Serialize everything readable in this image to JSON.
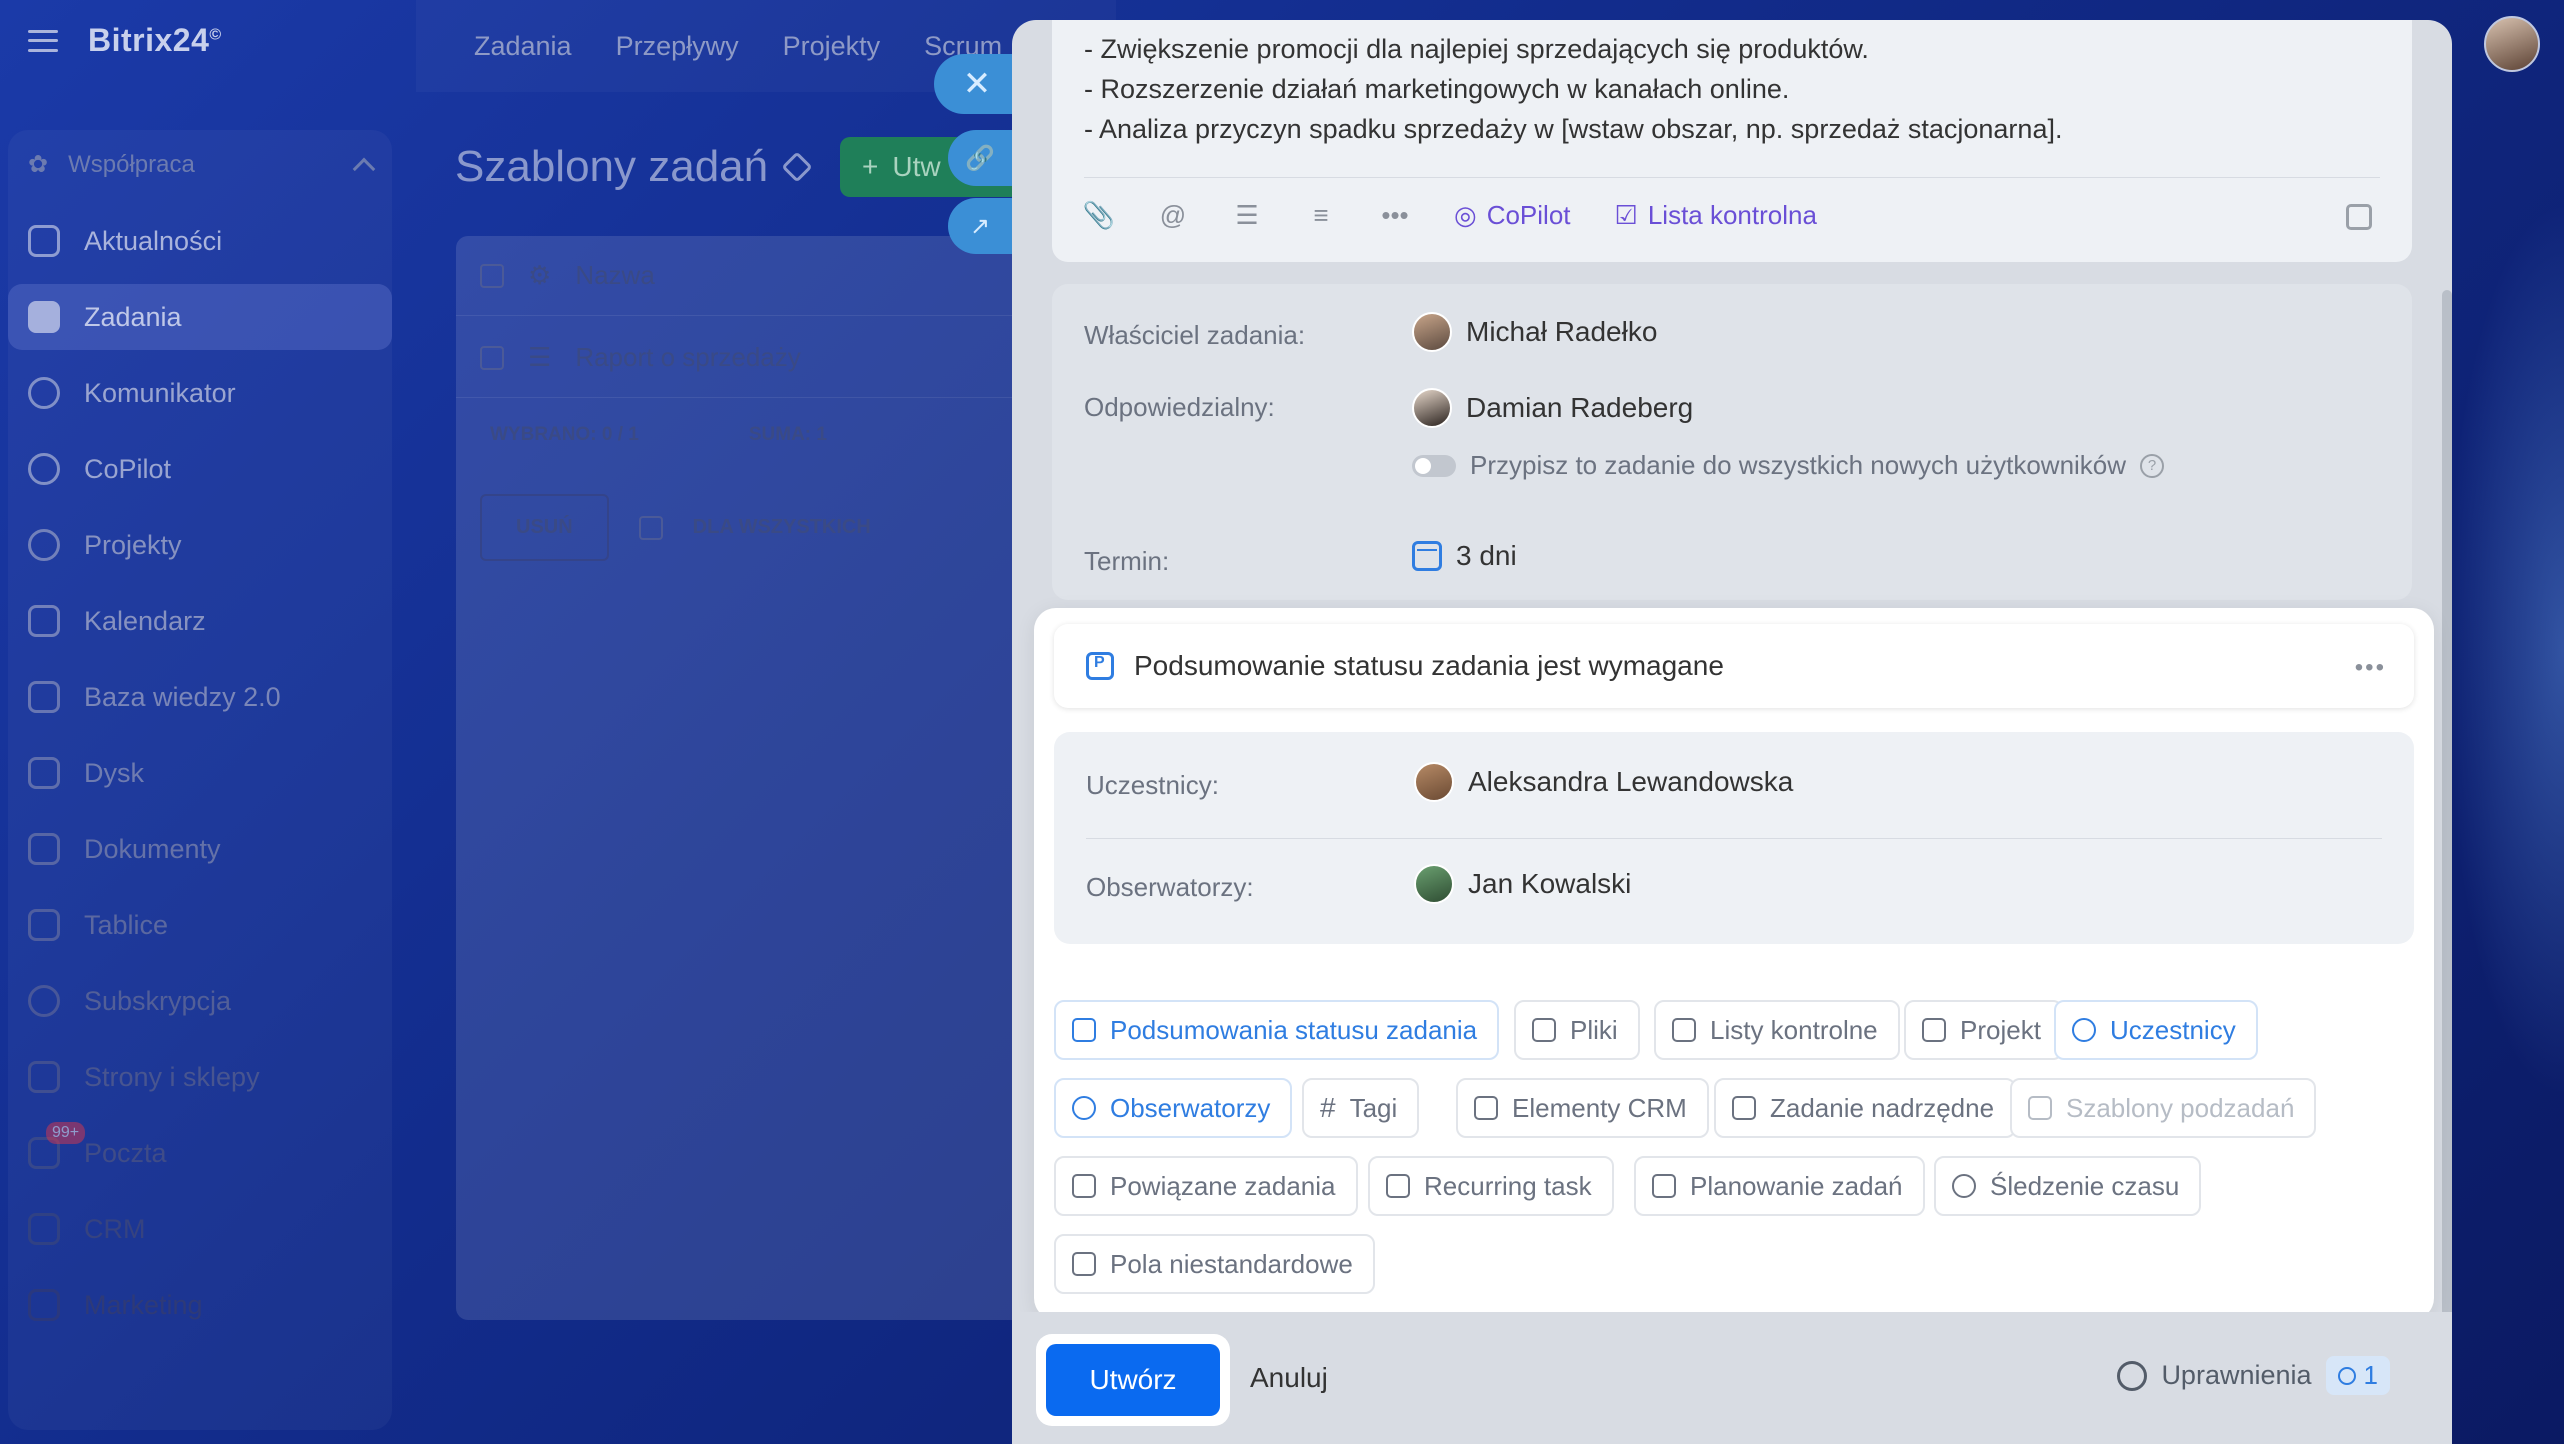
{
  "app": {
    "logo": "Bitrix24",
    "logo_mark": "©"
  },
  "sidebar": {
    "group_label": "Współpraca",
    "items": [
      {
        "label": "Aktualności"
      },
      {
        "label": "Zadania"
      },
      {
        "label": "Komunikator"
      },
      {
        "label": "CoPilot"
      },
      {
        "label": "Projekty"
      },
      {
        "label": "Kalendarz"
      },
      {
        "label": "Baza wiedzy 2.0"
      },
      {
        "label": "Dysk"
      },
      {
        "label": "Dokumenty"
      },
      {
        "label": "Tablice"
      },
      {
        "label": "Subskrypcja"
      },
      {
        "label": "Strony i sklepy"
      },
      {
        "label": "Poczta",
        "badge": "99+"
      },
      {
        "label": "CRM"
      },
      {
        "label": "Marketing"
      }
    ]
  },
  "topnav": {
    "items": [
      "Zadania",
      "Przepływy",
      "Projekty",
      "Scrum"
    ]
  },
  "page": {
    "title": "Szablony zadań",
    "create_label": "Utw",
    "grid": {
      "header": "Nazwa",
      "row": "Raport o sprzedaży",
      "selected": "WYBRANO: 0 / 1",
      "sum": "SUMA: 1",
      "delete": "USUŃ",
      "for_all": "DLA WSZYSTKICH"
    }
  },
  "slider": {
    "description_lines": [
      "- Zwiększenie promocji dla najlepiej sprzedających się produktów.",
      "- Rozszerzenie działań marketingowych w kanałach online.",
      "- Analiza przyczyn spadku sprzedaży w [wstaw obszar, np. sprzedaż stacjonarna]."
    ],
    "toolbar": {
      "copilot": "CoPilot",
      "checklist": "Lista kontrolna"
    },
    "owner": {
      "label": "Właściciel zadania:",
      "name": "Michał Radełko"
    },
    "responsible": {
      "label": "Odpowiedzialny:",
      "name": "Damian Radeberg",
      "assign_all": "Przypisz to zadanie do wszystkich nowych użytkowników"
    },
    "deadline": {
      "label": "Termin:",
      "value": "3 dni"
    },
    "summary_required": "Podsumowanie statusu zadania jest wymagane",
    "participants": {
      "label": "Uczestnicy:",
      "name": "Aleksandra Lewandowska"
    },
    "observers": {
      "label": "Obserwatorzy:",
      "name": "Jan Kowalski"
    },
    "chips": [
      "Podsumowania statusu zadania",
      "Pliki",
      "Listy kontrolne",
      "Projekt",
      "Uczestnicy",
      "Obserwatorzy",
      "Tagi",
      "Elementy CRM",
      "Zadanie nadrzędne",
      "Szablony podzadań",
      "Powiązane zadania",
      "Recurring task",
      "Planowanie zadań",
      "Śledzenie czasu",
      "Pola niestandardowe"
    ],
    "footer": {
      "create": "Utwórz",
      "cancel": "Anuluj",
      "permissions": "Uprawnienia",
      "permissions_count": "1"
    }
  },
  "colors": {
    "accent": "#0a6af0",
    "link": "#2f7de1",
    "copilot": "#6a4fd6",
    "create_green": "#1f7f59"
  }
}
